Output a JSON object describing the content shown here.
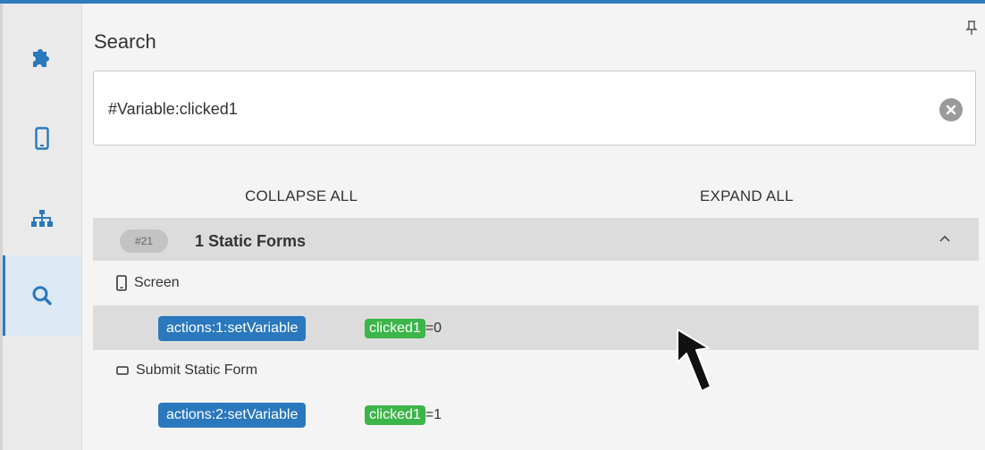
{
  "panel": {
    "title": "Search"
  },
  "search": {
    "value": "#Variable:clicked1",
    "placeholder": ""
  },
  "controls": {
    "collapse_label": "COLLAPSE ALL",
    "expand_label": "EXPAND ALL"
  },
  "results": {
    "group": {
      "badge": "#21",
      "title": "1 Static Forms"
    },
    "sections": [
      {
        "icon": "phone-icon",
        "label": "Screen",
        "action": "actions:1:setVariable",
        "variable": "clicked1",
        "value": "=0"
      },
      {
        "icon": "form-rect-icon",
        "label": "Submit Static Form",
        "action": "actions:2:setVariable",
        "variable": "clicked1",
        "value": "=1"
      }
    ]
  },
  "colors": {
    "accent": "#2f7bbf",
    "action_tag": "#2a78bd",
    "variable_tag": "#3cb54a"
  }
}
